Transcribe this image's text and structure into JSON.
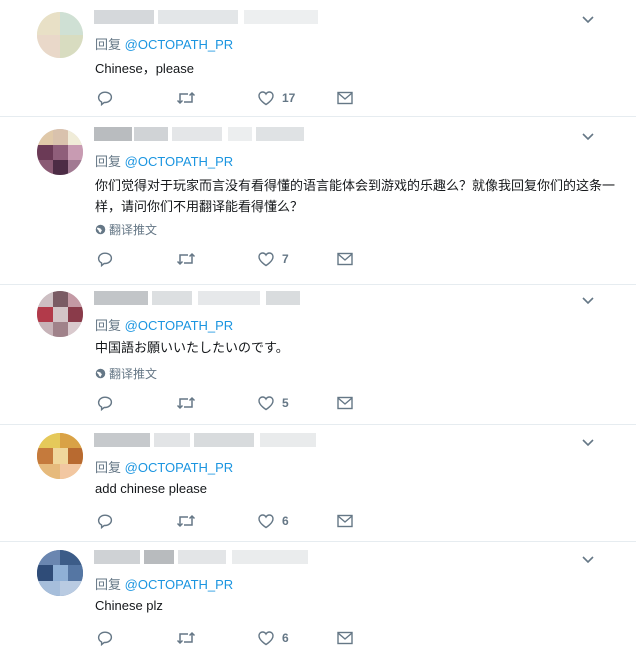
{
  "colors": {
    "handle": "#1b95e0",
    "muted": "#657786",
    "text": "#14171a",
    "divider": "#e6ecf0"
  },
  "icons": {
    "more": "chevron-down-icon",
    "reply": "reply-icon",
    "retweet": "retweet-icon",
    "like": "heart-icon",
    "dm": "envelope-icon",
    "globe": "globe-icon"
  },
  "tweets": [
    {
      "reply_prefix": "回复",
      "reply_handle": "@OCTOPATH_PR",
      "text": "Chinese，please",
      "translate_label": "",
      "like_count": "17"
    },
    {
      "reply_prefix": "回复",
      "reply_handle": "@OCTOPATH_PR",
      "text": "你们觉得对于玩家而言没有看得懂的语言能体会到游戏的乐趣么？就像我回复你们的这条一样，请问你们不用翻译能看得懂么？",
      "translate_label": "翻译推文",
      "like_count": "7"
    },
    {
      "reply_prefix": "回复",
      "reply_handle": "@OCTOPATH_PR",
      "text": "中国語お願いいたしたいのです。",
      "translate_label": "翻译推文",
      "like_count": "5"
    },
    {
      "reply_prefix": "回复",
      "reply_handle": "@OCTOPATH_PR",
      "text": "add chinese please",
      "translate_label": "",
      "like_count": "6"
    },
    {
      "reply_prefix": "回复",
      "reply_handle": "@OCTOPATH_PR",
      "text": "Chinese plz",
      "translate_label": "",
      "like_count": "6"
    }
  ]
}
